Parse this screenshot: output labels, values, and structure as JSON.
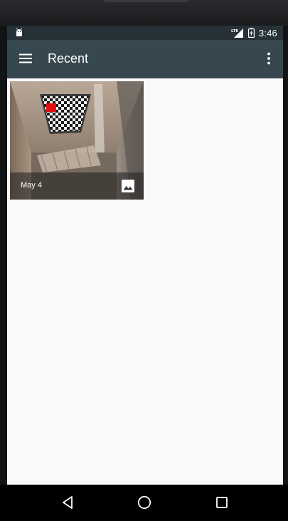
{
  "status_bar": {
    "network_label": "LTE",
    "time": "3:46",
    "icons": [
      "android-debug-icon",
      "lte-signal-icon",
      "battery-charging-icon"
    ]
  },
  "app_bar": {
    "title": "Recent",
    "icons": [
      "hamburger-menu-icon",
      "more-vertical-icon"
    ]
  },
  "grid": {
    "items": [
      {
        "date": "May 4",
        "type_icon": "image-icon"
      }
    ]
  },
  "nav_bar": {
    "icons": [
      "back-icon",
      "home-icon",
      "recents-icon"
    ]
  },
  "colors": {
    "status_bar": "#263238",
    "app_bar": "#37474f",
    "background": "#fafafa",
    "caption_overlay": "#282626"
  }
}
